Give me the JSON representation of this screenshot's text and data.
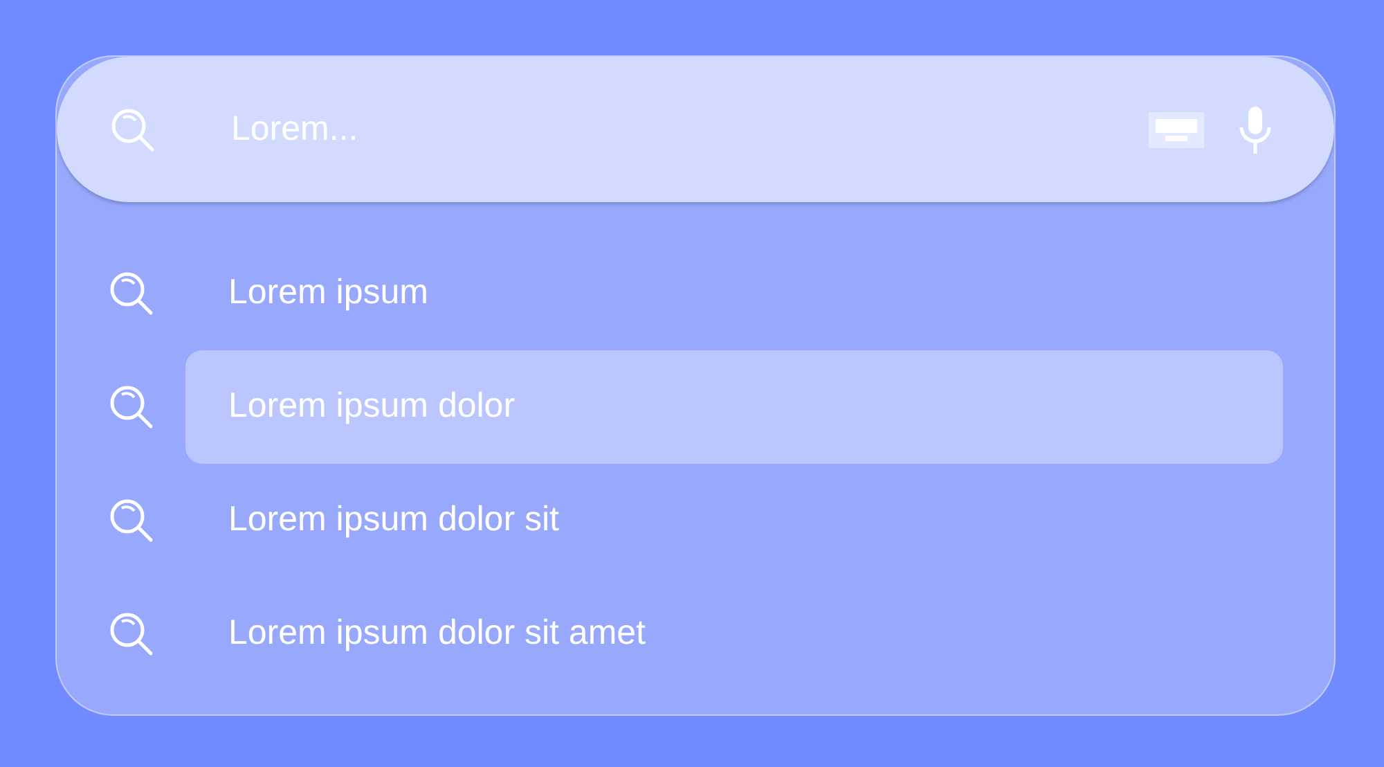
{
  "search": {
    "placeholder": "Lorem..."
  },
  "suggestions": [
    {
      "label": "Lorem ipsum",
      "selected": false
    },
    {
      "label": "Lorem ipsum dolor",
      "selected": true
    },
    {
      "label": "Lorem ipsum dolor sit",
      "selected": false
    },
    {
      "label": "Lorem ipsum dolor sit amet",
      "selected": false
    }
  ]
}
